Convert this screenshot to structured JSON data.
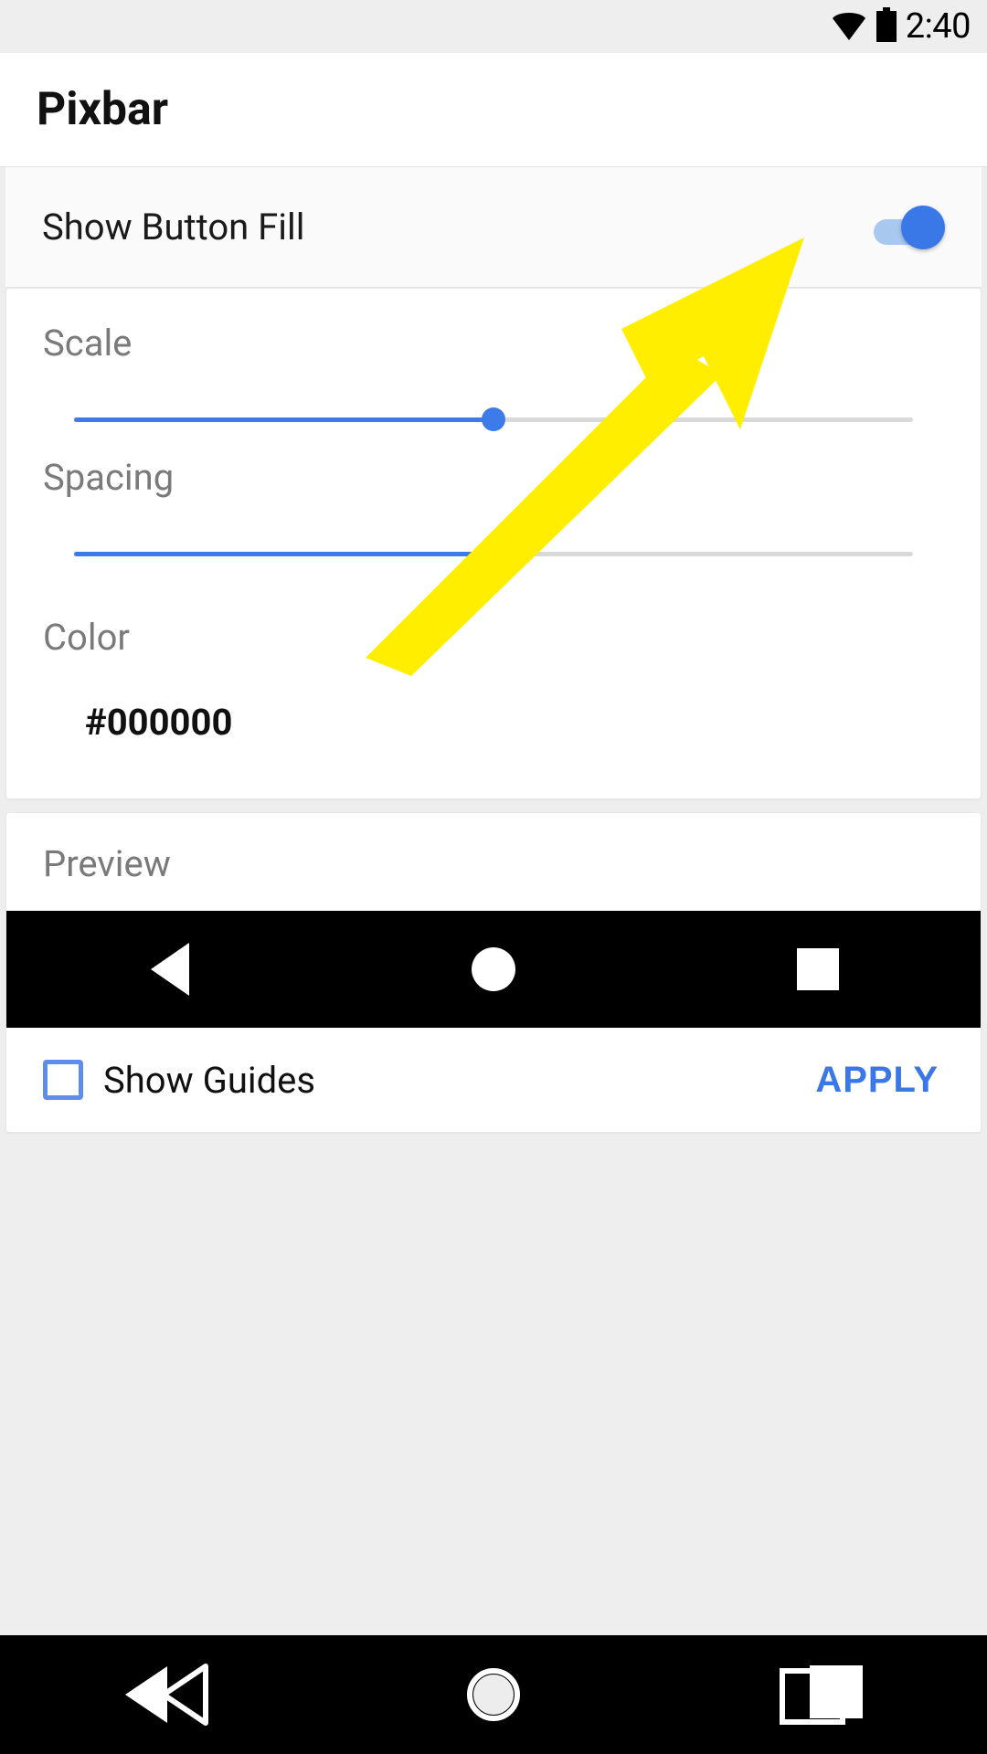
{
  "status": {
    "time": "2:40"
  },
  "header": {
    "title": "Pixbar"
  },
  "toggle": {
    "label": "Show Button Fill",
    "on": true
  },
  "sliders": {
    "scale": {
      "label": "Scale",
      "percent": 50
    },
    "spacing": {
      "label": "Spacing",
      "percent": 50
    }
  },
  "color": {
    "label": "Color",
    "value": "#000000"
  },
  "preview": {
    "label": "Preview",
    "show_guides_label": "Show Guides",
    "show_guides_checked": false,
    "apply_label": "APPLY"
  },
  "colors": {
    "accent": "#3b78e7"
  }
}
